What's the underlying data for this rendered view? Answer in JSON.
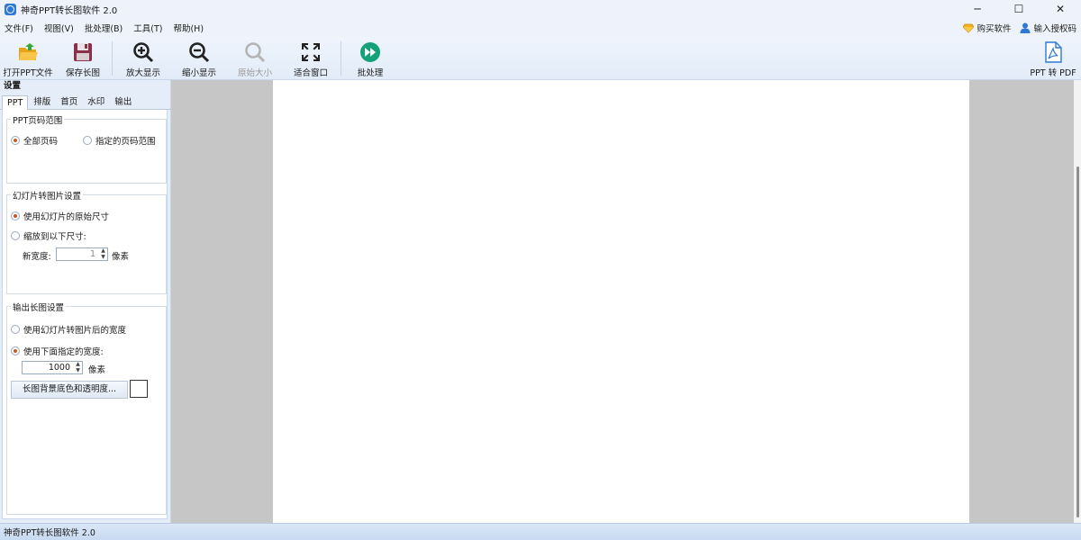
{
  "window": {
    "title": "神奇PPT转长图软件 2.0",
    "controls": {
      "minimize": "─",
      "maximize": "☐",
      "close": "✕"
    }
  },
  "menu": {
    "items": [
      "文件(F)",
      "视图(V)",
      "批处理(B)",
      "工具(T)",
      "帮助(H)"
    ],
    "right": {
      "buy": "购买软件",
      "license": "输入授权码"
    }
  },
  "toolbar": {
    "open": "打开PPT文件",
    "save": "保存长图",
    "zoom_in": "放大显示",
    "zoom_out": "缩小显示",
    "original": "原始大小",
    "fit": "适合窗口",
    "batch": "批处理",
    "ppt_to_pdf": "PPT 转 PDF"
  },
  "panel": {
    "header": "设置",
    "tabs": [
      "PPT",
      "排版",
      "首页",
      "水印",
      "输出"
    ],
    "active_tab": "PPT",
    "page_range": {
      "title": "PPT页码范围",
      "all_pages": "全部页码",
      "specified_range": "指定的页码范围",
      "selected": "all_pages"
    },
    "slide_to_image": {
      "title": "幻灯片转图片设置",
      "original_size": "使用幻灯片的原始尺寸",
      "scale_to": "缩放到以下尺寸:",
      "new_width_label": "新宽度:",
      "new_width_value": "1",
      "unit": "像素",
      "selected": "original_size"
    },
    "output_image": {
      "title": "输出长图设置",
      "use_slide_width": "使用幻灯片转图片后的宽度",
      "use_specified_width": "使用下面指定的宽度:",
      "width_value": "1000",
      "unit": "像素",
      "bg_button": "长图背景底色和透明度...",
      "swatch_color": "#ffffff",
      "selected": "use_specified_width"
    }
  },
  "statusbar": {
    "text": "神奇PPT转长图软件 2.0"
  },
  "colors": {
    "accent": "#2f78d6",
    "radio_selected": "#c75a1b",
    "canvas_gray": "#c6c6c6"
  }
}
